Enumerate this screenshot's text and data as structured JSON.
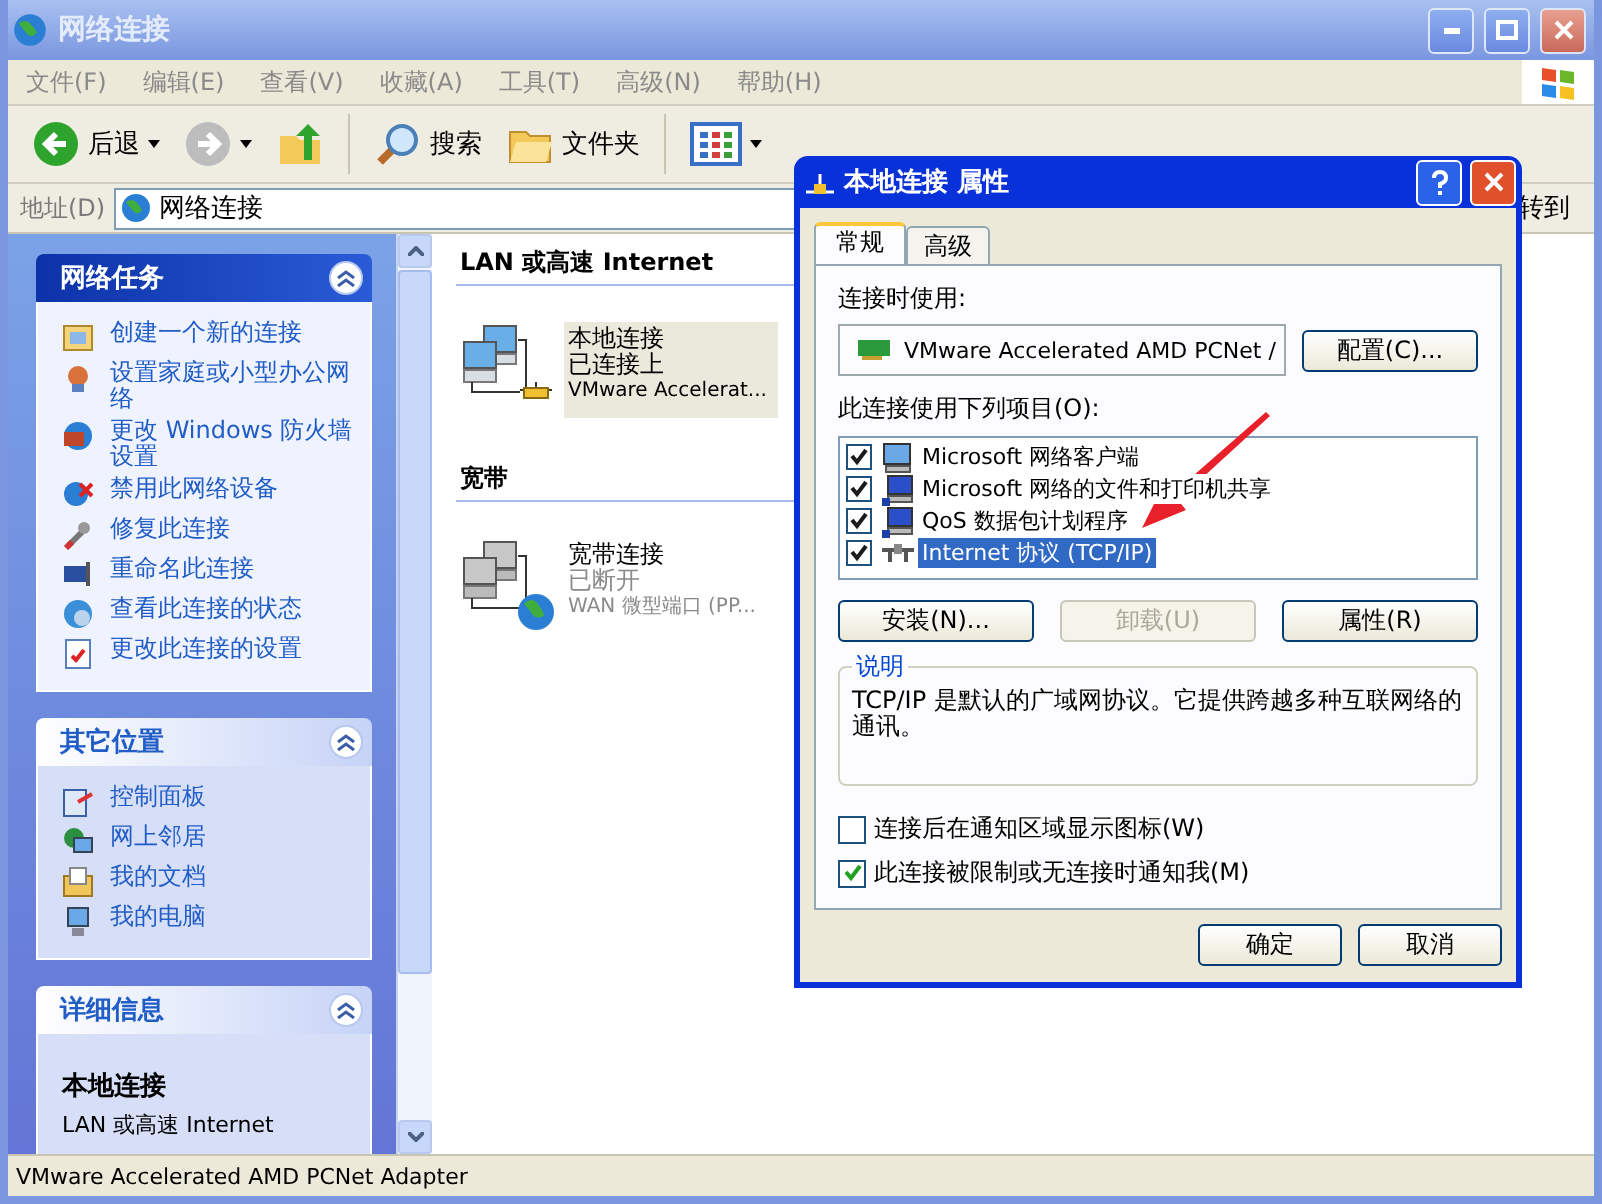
{
  "window": {
    "title": "网络连接"
  },
  "menu": [
    "文件(F)",
    "编辑(E)",
    "查看(V)",
    "收藏(A)",
    "工具(T)",
    "高级(N)",
    "帮助(H)"
  ],
  "toolbar": [
    {
      "kind": "back",
      "label": "后退"
    },
    {
      "kind": "forward"
    },
    {
      "kind": "up"
    },
    {
      "kind": "search",
      "label": "搜索"
    },
    {
      "kind": "folders",
      "label": "文件夹"
    },
    {
      "kind": "views"
    }
  ],
  "address": {
    "label": "地址(D)",
    "value": "网络连接",
    "go": "转到"
  },
  "sidebar": {
    "panels": [
      {
        "kind": "special",
        "title": "网络任务",
        "items": [
          "创建一个新的连接",
          "设置家庭或小型办公网络",
          "更改 Windows 防火墙设置",
          "禁用此网络设备",
          "修复此连接",
          "重命名此连接",
          "查看此连接的状态",
          "更改此连接的设置"
        ]
      },
      {
        "kind": "normal",
        "title": "其它位置",
        "items": [
          "控制面板",
          "网上邻居",
          "我的文档",
          "我的电脑"
        ]
      },
      {
        "kind": "details",
        "title": "详细信息",
        "heading": "本地连接",
        "lines": [
          "LAN 或高速 Internet"
        ]
      }
    ]
  },
  "groups": [
    {
      "title": "LAN 或高速 Internet",
      "connections": [
        {
          "kind": "lan",
          "name": "本地连接",
          "status": "已连接上",
          "device": "VMware Accelerat...",
          "connected": true,
          "selected": true
        }
      ]
    },
    {
      "title": "宽带",
      "connections": [
        {
          "kind": "broadband",
          "name": "宽带连接",
          "status": "已断开",
          "device": "WAN 微型端口 (PP...",
          "connected": false,
          "selected": false
        }
      ]
    }
  ],
  "status_bar": "VMware Accelerated AMD PCNet Adapter",
  "dialog": {
    "title": "本地连接 属性",
    "tabs": [
      {
        "label": "常规",
        "selected": true
      },
      {
        "label": "高级",
        "selected": false
      }
    ],
    "connect_using_label": "连接时使用:",
    "adapter": "VMware Accelerated AMD PCNet /",
    "configure_button": "配置(C)...",
    "items_label": "此连接使用下列项目(O):",
    "items": [
      {
        "kind": "client",
        "label": "Microsoft 网络客户端",
        "checked": true,
        "selected": false
      },
      {
        "kind": "service",
        "label": "Microsoft 网络的文件和打印机共享",
        "checked": true,
        "selected": false
      },
      {
        "kind": "service",
        "label": "QoS 数据包计划程序",
        "checked": true,
        "selected": false
      },
      {
        "kind": "protocol",
        "label": "Internet 协议 (TCP/IP)",
        "checked": true,
        "selected": true
      }
    ],
    "item_buttons": [
      {
        "label": "安装(N)...",
        "disabled": false
      },
      {
        "label": "卸载(U)",
        "disabled": true
      },
      {
        "label": "属性(R)",
        "disabled": false
      }
    ],
    "description": {
      "title": "说明",
      "text": "TCP/IP 是默认的广域网协议。它提供跨越多种互联网络的通讯。"
    },
    "options": [
      {
        "label": "连接后在通知区域显示图标(W)",
        "checked": false
      },
      {
        "label": "此连接被限制或无连接时通知我(M)",
        "checked": true
      }
    ],
    "buttons": [
      "确定",
      "取消"
    ]
  }
}
